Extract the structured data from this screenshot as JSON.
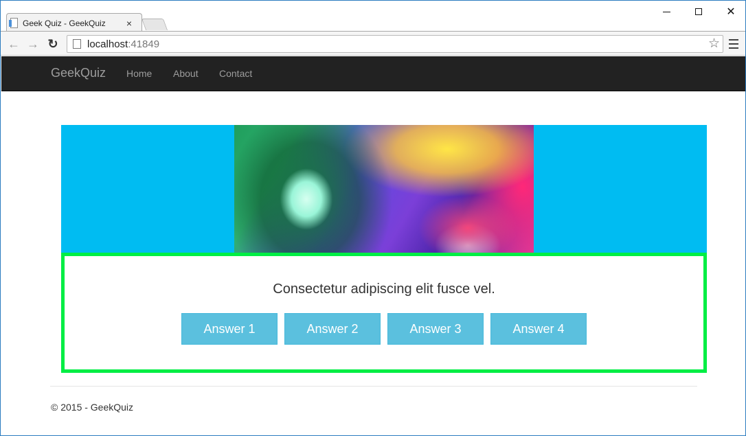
{
  "browser": {
    "tab_title": "Geek Quiz - GeekQuiz",
    "tab_close_glyph": "×",
    "url_host": "localhost",
    "url_port": ":41849",
    "back_glyph": "←",
    "forward_glyph": "→",
    "reload_glyph": "↻",
    "star_glyph": "☆",
    "close_glyph": "✕"
  },
  "navbar": {
    "brand": "GeekQuiz",
    "links": [
      "Home",
      "About",
      "Contact"
    ]
  },
  "quiz": {
    "question": "Consectetur adipiscing elit fusce vel.",
    "answers": [
      "Answer 1",
      "Answer 2",
      "Answer 3",
      "Answer 4"
    ],
    "panel_border_color": "#00ee44",
    "hero_color": "#00bcf2",
    "button_color": "#5bc0de"
  },
  "footer": {
    "text": "© 2015 - GeekQuiz"
  },
  "icons": {
    "favicon": "page-icon",
    "omnibox_icon": "page-icon",
    "bookmark": "star-icon",
    "menu": "hamburger-icon"
  }
}
